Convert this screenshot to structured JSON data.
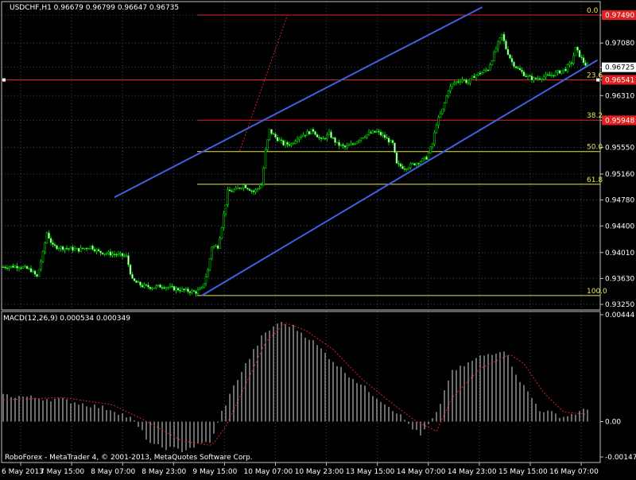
{
  "window": {
    "symbol_title": "USDCHF,H1  0.96679 0.96799 0.96647 0.96735",
    "copyright": "RoboForex - MetaTrader 4, © 2001-2013, MetaQuotes Software Corp."
  },
  "colors": {
    "background": "#000000",
    "grid": "#3a4a6a",
    "candle": "#00c800",
    "channel": "#4060e0",
    "fibo": "#e8e850",
    "fibo_red": "#e02020",
    "price_label_bg": "#e02020",
    "macd_hist": "#d8d8d8",
    "macd_signal": "#e02020",
    "text": "#ffffff"
  },
  "chart_data": [
    {
      "type": "candlestick",
      "panel": "price",
      "y_ticks": [
        "0.97490",
        "0.97080",
        "0.96725",
        "0.96541",
        "0.96310",
        "0.95948",
        "0.95550",
        "0.95160",
        "0.94780",
        "0.94400",
        "0.94010",
        "0.93630",
        "0.93250"
      ],
      "ylim": [
        0.9325,
        0.9749
      ],
      "current_price": "0.96725",
      "highlighted_prices": [
        "0.97490",
        "0.96541",
        "0.95948"
      ],
      "x_labels": [
        "6 May 2013",
        "7 May 15:00",
        "8 May 07:00",
        "8 May 23:00",
        "9 May 15:00",
        "10 May 07:00",
        "10 May 23:00",
        "13 May 15:00",
        "14 May 07:00",
        "14 May 23:00",
        "15 May 15:00",
        "16 May 07:00"
      ],
      "fibonacci": {
        "levels": [
          {
            "label": "0.0",
            "price": 0.9749,
            "style": "red"
          },
          {
            "label": "23.6",
            "price": 0.9654,
            "style": "red"
          },
          {
            "label": "38.2",
            "price": 0.9595,
            "style": "red"
          },
          {
            "label": "50.0",
            "price": 0.9549,
            "style": "yellow"
          },
          {
            "label": "61.8",
            "price": 0.9501,
            "style": "yellow"
          },
          {
            "label": "100.0",
            "price": 0.9338,
            "style": "yellow"
          }
        ]
      },
      "channel": {
        "upper": [
          {
            "bar": 56,
            "price": 0.9482
          },
          {
            "bar": 241,
            "price": 0.9749
          }
        ],
        "lower": [
          {
            "bar": 100,
            "price": 0.9338
          },
          {
            "bar": 299,
            "price": 0.9683
          }
        ]
      },
      "trend_line": [
        {
          "bar": 119,
          "price": 0.955
        },
        {
          "bar": 143,
          "price": 0.9749
        }
      ],
      "close_path": [
        [
          0,
          0.938
        ],
        [
          8,
          0.9381
        ],
        [
          14,
          0.9375
        ],
        [
          17,
          0.9365
        ],
        [
          20,
          0.94
        ],
        [
          22,
          0.943
        ],
        [
          25,
          0.941
        ],
        [
          30,
          0.9408
        ],
        [
          38,
          0.9405
        ],
        [
          44,
          0.941
        ],
        [
          48,
          0.9402
        ],
        [
          52,
          0.94
        ],
        [
          57,
          0.9398
        ],
        [
          62,
          0.9395
        ],
        [
          65,
          0.936
        ],
        [
          70,
          0.9352
        ],
        [
          75,
          0.935
        ],
        [
          80,
          0.9352
        ],
        [
          86,
          0.9348
        ],
        [
          92,
          0.9345
        ],
        [
          97,
          0.9343
        ],
        [
          100,
          0.9348
        ],
        [
          103,
          0.9375
        ],
        [
          105,
          0.941
        ],
        [
          108,
          0.941
        ],
        [
          110,
          0.944
        ],
        [
          113,
          0.949
        ],
        [
          117,
          0.9493
        ],
        [
          121,
          0.95
        ],
        [
          126,
          0.949
        ],
        [
          130,
          0.95
        ],
        [
          132,
          0.955
        ],
        [
          134,
          0.958
        ],
        [
          137,
          0.957
        ],
        [
          141,
          0.956
        ],
        [
          145,
          0.956
        ],
        [
          148,
          0.957
        ],
        [
          152,
          0.9575
        ],
        [
          156,
          0.958
        ],
        [
          160,
          0.9565
        ],
        [
          164,
          0.9575
        ],
        [
          168,
          0.956
        ],
        [
          172,
          0.9555
        ],
        [
          176,
          0.956
        ],
        [
          180,
          0.957
        ],
        [
          184,
          0.9575
        ],
        [
          188,
          0.9578
        ],
        [
          192,
          0.957
        ],
        [
          196,
          0.956
        ],
        [
          198,
          0.953
        ],
        [
          202,
          0.9525
        ],
        [
          206,
          0.953
        ],
        [
          210,
          0.9535
        ],
        [
          213,
          0.954
        ],
        [
          216,
          0.956
        ],
        [
          218,
          0.959
        ],
        [
          221,
          0.961
        ],
        [
          224,
          0.964
        ],
        [
          227,
          0.965
        ],
        [
          231,
          0.9655
        ],
        [
          234,
          0.965
        ],
        [
          237,
          0.966
        ],
        [
          241,
          0.9665
        ],
        [
          244,
          0.967
        ],
        [
          248,
          0.97
        ],
        [
          251,
          0.972
        ],
        [
          253,
          0.97
        ],
        [
          256,
          0.968
        ],
        [
          259,
          0.967
        ],
        [
          263,
          0.966
        ],
        [
          267,
          0.9655
        ],
        [
          271,
          0.9658
        ],
        [
          275,
          0.966
        ],
        [
          279,
          0.9665
        ],
        [
          283,
          0.967
        ],
        [
          286,
          0.968
        ],
        [
          288,
          0.97
        ],
        [
          290,
          0.969
        ],
        [
          292,
          0.968
        ],
        [
          294,
          0.9673
        ]
      ]
    },
    {
      "type": "bar",
      "panel": "indicator",
      "title": "MACD(12,26,9) 0.000534 0.000349",
      "y_ticks": [
        "0.00444",
        "0.00",
        "-0.00147"
      ],
      "ylim": [
        -0.00147,
        0.00444
      ],
      "hist_path": [
        [
          0,
          0.0011
        ],
        [
          30,
          0.0009
        ],
        [
          55,
          0.0005
        ],
        [
          65,
          0.0001
        ],
        [
          75,
          -0.001
        ],
        [
          90,
          -0.0012
        ],
        [
          105,
          -0.0008
        ],
        [
          110,
          0.0004
        ],
        [
          118,
          0.0018
        ],
        [
          130,
          0.0035
        ],
        [
          138,
          0.0041
        ],
        [
          145,
          0.004
        ],
        [
          155,
          0.0034
        ],
        [
          170,
          0.0022
        ],
        [
          185,
          0.0012
        ],
        [
          198,
          0.0004
        ],
        [
          210,
          -0.0006
        ],
        [
          218,
          0.0003
        ],
        [
          225,
          0.002
        ],
        [
          240,
          0.0027
        ],
        [
          252,
          0.003
        ],
        [
          260,
          0.0017
        ],
        [
          270,
          0.0005
        ],
        [
          282,
          0.0002
        ],
        [
          294,
          0.0005
        ]
      ],
      "signal_path": [
        [
          0,
          0.0009
        ],
        [
          30,
          0.001
        ],
        [
          55,
          0.0007
        ],
        [
          70,
          0.0001
        ],
        [
          90,
          -0.0008
        ],
        [
          105,
          -0.001
        ],
        [
          112,
          -0.0002
        ],
        [
          120,
          0.0012
        ],
        [
          132,
          0.0033
        ],
        [
          142,
          0.0041
        ],
        [
          152,
          0.0038
        ],
        [
          166,
          0.003
        ],
        [
          180,
          0.0018
        ],
        [
          195,
          0.0008
        ],
        [
          208,
          0.0
        ],
        [
          218,
          -0.0004
        ],
        [
          226,
          0.001
        ],
        [
          240,
          0.0022
        ],
        [
          255,
          0.0028
        ],
        [
          262,
          0.0024
        ],
        [
          272,
          0.0012
        ],
        [
          282,
          0.0004
        ],
        [
          294,
          0.0003
        ]
      ]
    }
  ]
}
